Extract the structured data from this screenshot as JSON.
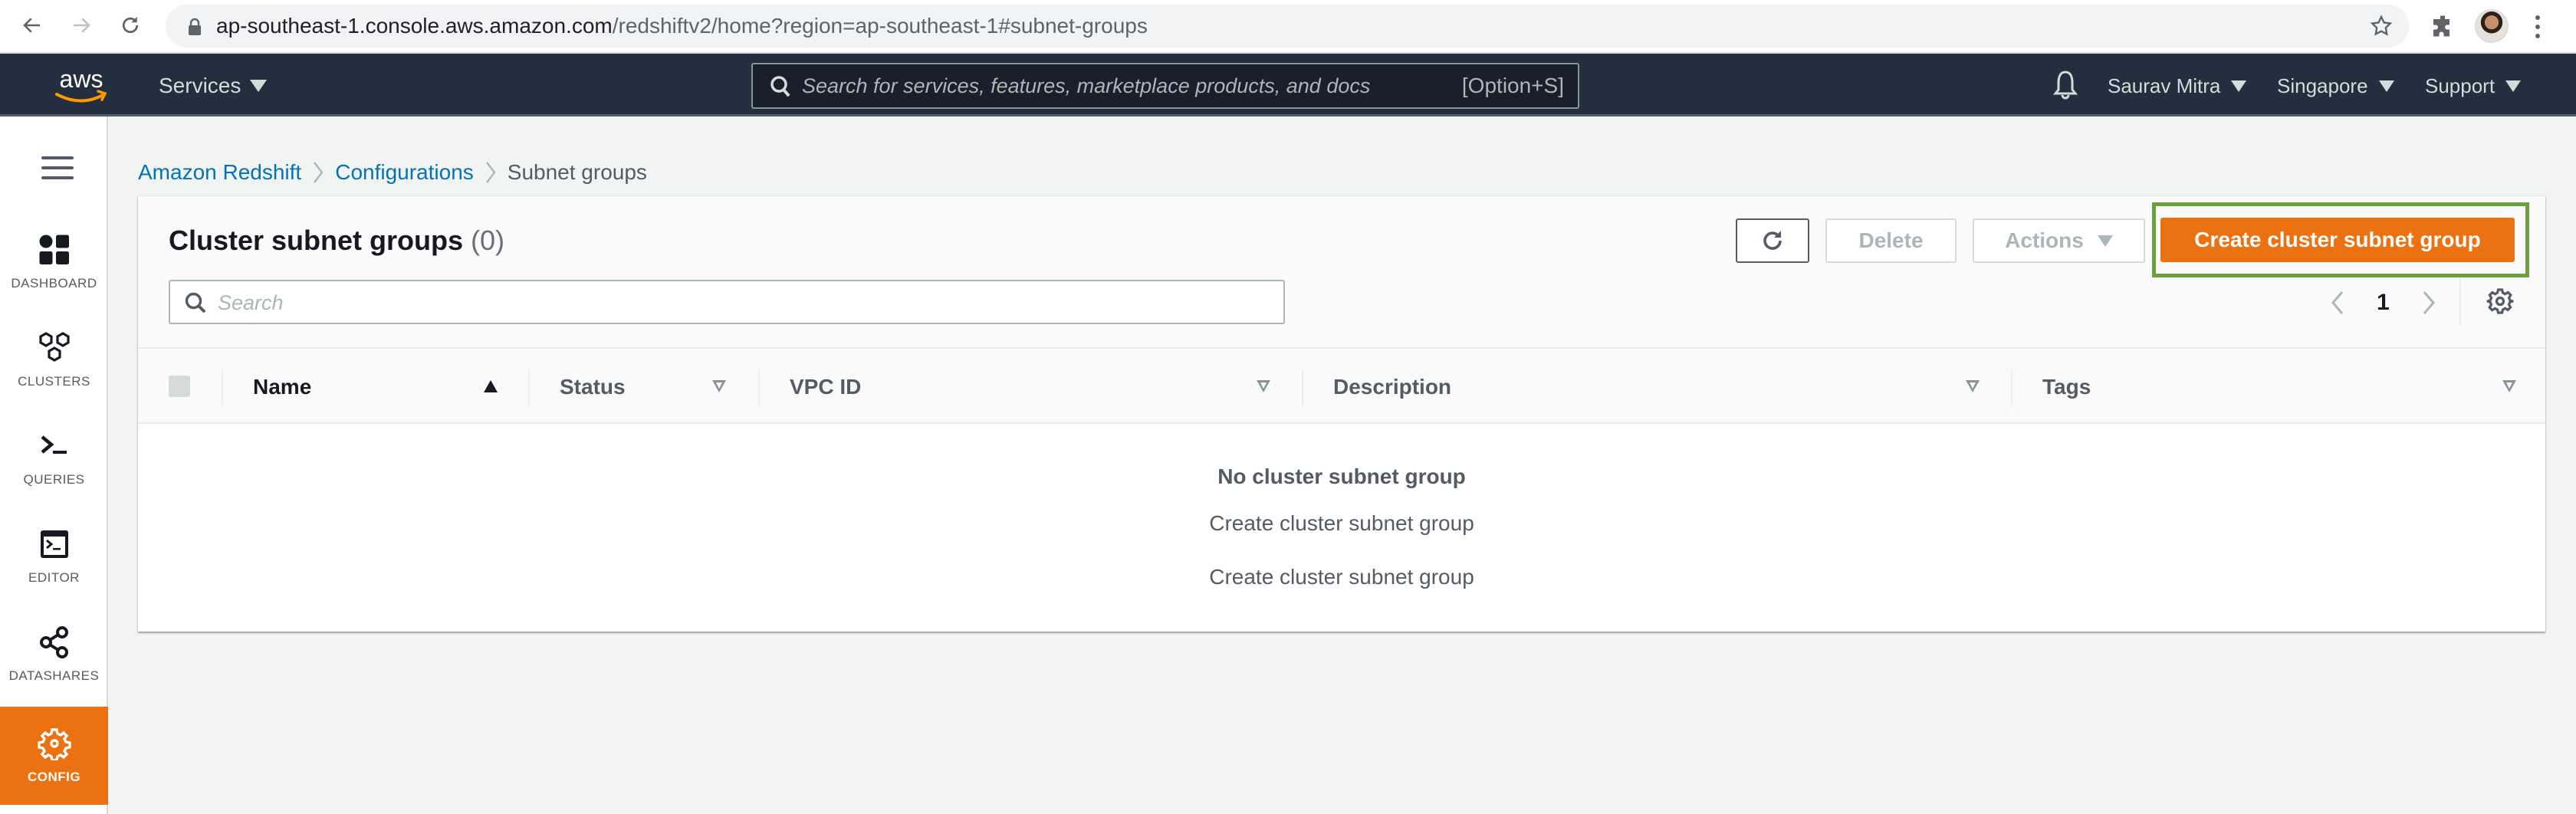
{
  "browser": {
    "url_host": "ap-southeast-1.console.aws.amazon.com",
    "url_path": "/redshiftv2/home?region=ap-southeast-1#subnet-groups",
    "icons": [
      "back-icon",
      "forward-icon",
      "reload-icon",
      "lock-icon",
      "bookmark-star-icon",
      "extensions-icon",
      "profile-avatar",
      "more-menu-icon"
    ]
  },
  "topnav": {
    "logo_text": "aws",
    "services_label": "Services",
    "search_placeholder": "Search for services, features, marketplace products, and docs",
    "search_shortcut": "[Option+S]",
    "user_label": "Saurav Mitra",
    "region_label": "Singapore",
    "support_label": "Support"
  },
  "sidebar": {
    "items": [
      {
        "label": "DASHBOARD",
        "icon": "dashboard-icon",
        "active": false
      },
      {
        "label": "CLUSTERS",
        "icon": "clusters-icon",
        "active": false
      },
      {
        "label": "QUERIES",
        "icon": "queries-icon",
        "active": false
      },
      {
        "label": "EDITOR",
        "icon": "editor-icon",
        "active": false
      },
      {
        "label": "DATASHARES",
        "icon": "datashares-icon",
        "active": false
      },
      {
        "label": "CONFIG",
        "icon": "config-gear-icon",
        "active": true
      }
    ]
  },
  "breadcrumb": {
    "items": [
      {
        "label": "Amazon Redshift",
        "link": true
      },
      {
        "label": "Configurations",
        "link": true
      },
      {
        "label": "Subnet groups",
        "link": false
      }
    ]
  },
  "panel": {
    "title": "Cluster subnet groups",
    "count": "(0)",
    "delete_label": "Delete",
    "actions_label": "Actions",
    "create_label": "Create cluster subnet group",
    "search_placeholder": "Search",
    "search_value": "",
    "current_page": "1"
  },
  "table": {
    "columns": [
      {
        "label": "Name",
        "sort": "ascending"
      },
      {
        "label": "Status",
        "sort": "none"
      },
      {
        "label": "VPC ID",
        "sort": "none"
      },
      {
        "label": "Description",
        "sort": "none"
      },
      {
        "label": "Tags",
        "sort": "none"
      }
    ],
    "rows": [],
    "empty_title": "No cluster subnet group",
    "empty_line_1": "Create cluster subnet group",
    "empty_line_2": "Create cluster subnet group"
  },
  "colors": {
    "nav_bg": "#232f3e",
    "accent_orange": "#ec7211",
    "link_blue": "#0073bb",
    "highlight_green": "#6aa03d"
  }
}
